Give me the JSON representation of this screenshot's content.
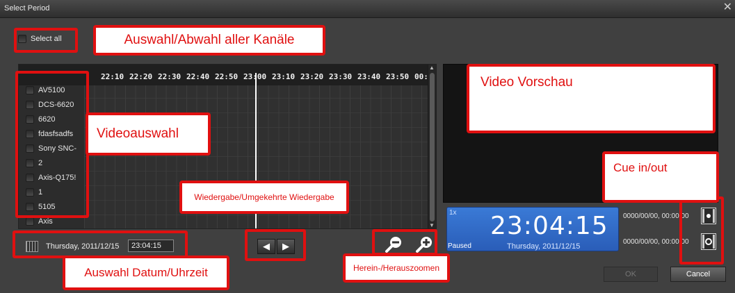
{
  "window": {
    "title": "Select Period",
    "close_glyph": "✕"
  },
  "select_all": {
    "label": "Select all",
    "checked": false
  },
  "timeline": {
    "ticks": [
      "22:10",
      "22:20",
      "22:30",
      "22:40",
      "22:50",
      "23:00",
      "23:10",
      "23:20",
      "23:30",
      "23:40",
      "23:50",
      "00:"
    ],
    "channels": [
      "AV5100",
      "DCS-6620",
      "6620",
      "fdasfsadfs",
      "Sony SNC-",
      "2",
      "Axis-Q175!",
      "1",
      "5105",
      "Axis"
    ]
  },
  "datetime": {
    "date": "Thursday, 2011/12/15",
    "time": "23:04:15",
    "icon": "calendar-icon"
  },
  "playback": {
    "reverse_icon": "reverse-play-icon",
    "forward_icon": "play-icon",
    "reverse_glyph": "◀",
    "forward_glyph": "▶"
  },
  "zoom": {
    "out_icon": "zoom-out-icon",
    "in_icon": "zoom-in-icon"
  },
  "clock": {
    "speed": "1x",
    "time": "23:04:15",
    "status": "Paused",
    "date": "Thursday, 2011/12/15"
  },
  "cue": {
    "in_value": "0000/00/00, 00:00:00",
    "out_value": "0000/00/00, 00:00:00",
    "in_icon": "cue-in-icon",
    "out_icon": "cue-out-icon"
  },
  "buttons": {
    "ok": "OK",
    "cancel": "Cancel"
  },
  "annotations": {
    "select_all": "Auswahl/Abwahl aller Kanäle",
    "preview": "Video Vorschau",
    "video_select": "Videoauswahl",
    "cue": "Cue in/out",
    "playback": "Wiedergabe/Umgekehrte Wiedergabe",
    "datetime": "Auswahl Datum/Uhrzeit",
    "zoom": "Herein-/Herauszoomen"
  },
  "colors": {
    "annotation_red": "#e01010",
    "clock_blue": "#3a7ad6"
  }
}
